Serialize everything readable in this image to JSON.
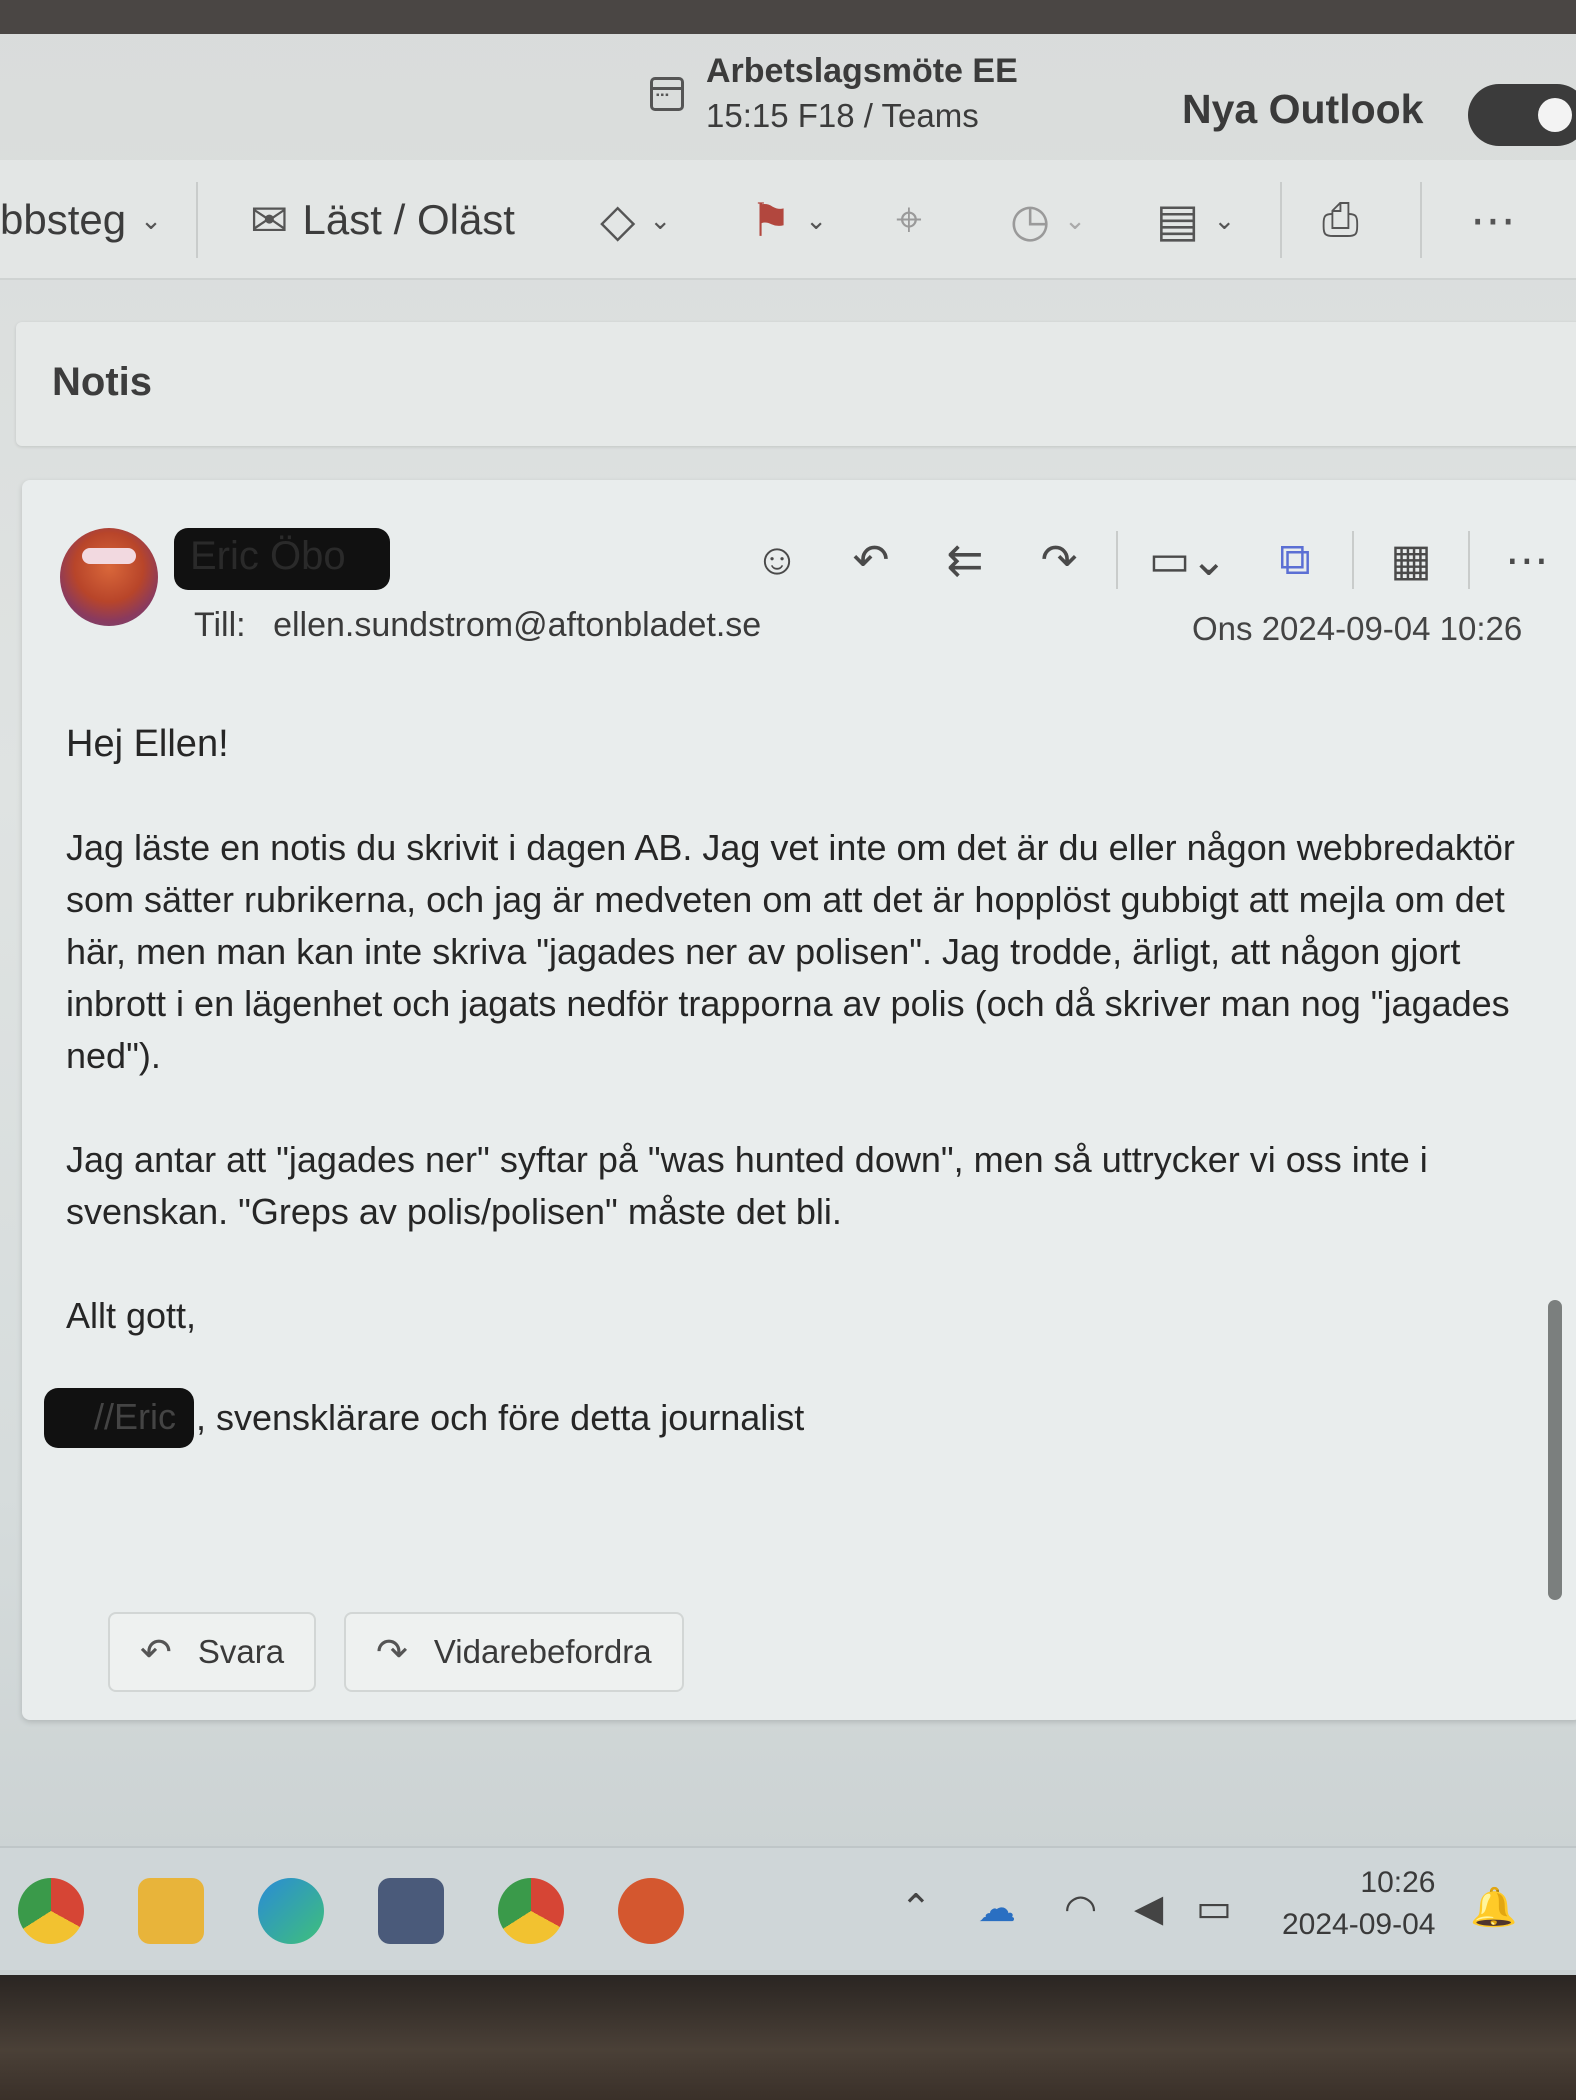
{
  "meeting": {
    "title": "Arbetslagsmöte EE",
    "subtitle": "15:15 F18 / Teams"
  },
  "header": {
    "new_outlook_label": "Nya Outlook"
  },
  "toolbar": {
    "cut_label": "bbsteg",
    "read_label": "Läst / Oläst"
  },
  "section": {
    "title": "Notis"
  },
  "message": {
    "sender": "Eric Öbo",
    "to_label": "Till:",
    "to_address": "ellen.sundstrom@aftonbladet.se",
    "date": "Ons 2024-09-04 10:26",
    "greeting": "Hej Ellen!",
    "paragraph1": "Jag läste en notis du skrivit i dagen AB. Jag vet inte om det är du eller någon webbredaktör som sätter rubrikerna, och jag är medveten om att det är hopplöst gubbigt att mejla om det här, men man kan inte skriva \"jagades ner av polisen\". Jag trodde, ärligt, att någon gjort inbrott i en lägenhet och jagats nedför trapporna av polis (och då skriver man nog \"jagades ned\").",
    "paragraph2": "Jag antar att \"jagades ner\" syftar på \"was hunted down\", men så uttrycker vi oss inte i svenskan. \"Greps av polis/polisen\" måste det bli.",
    "closing": "Allt gott,",
    "signature_name": "//Eric",
    "signature_rest": ", svensklärare och före detta journalist"
  },
  "buttons": {
    "reply": "Svara",
    "forward": "Vidarebefordra"
  },
  "taskbar": {
    "time": "10:26",
    "date": "2024-09-04"
  }
}
